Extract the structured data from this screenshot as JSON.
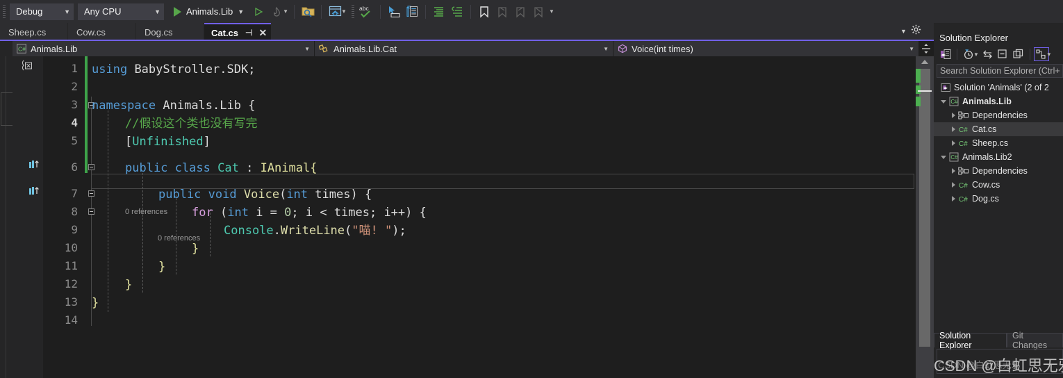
{
  "toolbar": {
    "config_combo": "Debug",
    "platform_combo": "Any CPU",
    "run_label": "Animals.Lib",
    "icons": [
      "folder-search-icon",
      "window-home-icon",
      "abc-spellcheck-icon",
      "pointer-comment-icon",
      "clipboard-list-icon",
      "comment-out-icon",
      "uncomment-icon",
      "bookmark-icon",
      "bookmark-prev-icon",
      "bookmark-next-icon",
      "bookmark-clear-icon"
    ]
  },
  "tabs": {
    "items": [
      {
        "label": "Sheep.cs",
        "active": false
      },
      {
        "label": "Cow.cs",
        "active": false
      },
      {
        "label": "Dog.cs",
        "active": false
      },
      {
        "label": "Cat.cs",
        "active": true
      }
    ],
    "pin_glyph": "⊣",
    "close_glyph": "✕"
  },
  "navbar": {
    "project": "Animals.Lib",
    "type": "Animals.Lib.Cat",
    "member": "Voice(int times)",
    "project_icon": "csharp-project-icon",
    "type_icon": "class-icon",
    "member_icon": "method-icon",
    "split_icon": "split-view-icon"
  },
  "editor": {
    "lines": [
      {
        "n": "1",
        "current": false
      },
      {
        "n": "2",
        "current": false
      },
      {
        "n": "3",
        "current": false
      },
      {
        "n": "4",
        "current": true
      },
      {
        "n": "5",
        "current": false
      },
      {
        "n": "6",
        "current": false
      },
      {
        "n": "7",
        "current": false
      },
      {
        "n": "8",
        "current": false
      },
      {
        "n": "9",
        "current": false
      },
      {
        "n": "10",
        "current": false
      },
      {
        "n": "11",
        "current": false
      },
      {
        "n": "12",
        "current": false
      },
      {
        "n": "13",
        "current": false
      },
      {
        "n": "14",
        "current": false
      }
    ],
    "code": {
      "l1_using": "using",
      "l1_ns": "BabyStroller.SDK;",
      "l3_kw": "namespace",
      "l3_name": "Animals.Lib {",
      "l4_comment": "//假设这个类也没有写完",
      "l5_attr_open": "[",
      "l5_attr": "Unfinished",
      "l5_attr_close": "]",
      "l6_public": "public",
      "l6_class": "class",
      "l6_name": "Cat",
      "l6_colon": ":",
      "l6_iface": "IAnimal{",
      "l7_public": "public",
      "l7_void": "void",
      "l7_method": "Voice",
      "l7_paren_open": "(",
      "l7_int": "int",
      "l7_param": "times",
      "l7_paren_close": ") {",
      "l8_for": "for",
      "l8_open": "(",
      "l8_int": "int",
      "l8_i": "i = ",
      "l8_zero": "0",
      "l8_semi": "; i < times; i++) {",
      "l9_console": "Console",
      "l9_dot": ".",
      "l9_write": "WriteLine",
      "l9_open": "(",
      "l9_str": "\"喵! \"",
      "l9_close": ");",
      "l10_brace": "}",
      "l11_brace": "}",
      "l12_brace": "}",
      "l13_brace": "}"
    },
    "codelens": [
      {
        "text": "0 references",
        "for": "class Cat"
      },
      {
        "text": "0 references",
        "for": "method Voice"
      }
    ],
    "glyphs": [
      "implements-interface-icon",
      "implements-interface-icon"
    ]
  },
  "solution_explorer": {
    "title": "Solution Explorer",
    "search_placeholder": "Search Solution Explorer (Ctrl+",
    "toolbar_icons": [
      "code-view-icon",
      "pending-changes-clock-icon",
      "sync-with-active-doc-icon",
      "collapse-all-icon",
      "show-all-files-icon",
      "properties-icon"
    ],
    "tree": [
      {
        "label": "Solution 'Animals' (2 of 2",
        "icon": "solution-icon",
        "indent": 0,
        "expander": "none",
        "bold": false,
        "selected": false
      },
      {
        "label": "Animals.Lib",
        "icon": "csharp-project-icon",
        "indent": 1,
        "expander": "down",
        "bold": true,
        "selected": false
      },
      {
        "label": "Dependencies",
        "icon": "dependencies-icon",
        "indent": 2,
        "expander": "right",
        "bold": false,
        "selected": false
      },
      {
        "label": "Cat.cs",
        "icon": "csharp-file-icon",
        "indent": 2,
        "expander": "right",
        "bold": false,
        "selected": true
      },
      {
        "label": "Sheep.cs",
        "icon": "csharp-file-icon",
        "indent": 2,
        "expander": "right",
        "bold": false,
        "selected": false
      },
      {
        "label": "Animals.Lib2",
        "icon": "csharp-project-icon",
        "indent": 1,
        "expander": "down",
        "bold": false,
        "selected": false
      },
      {
        "label": "Dependencies",
        "icon": "dependencies-icon",
        "indent": 2,
        "expander": "right",
        "bold": false,
        "selected": false
      },
      {
        "label": "Cow.cs",
        "icon": "csharp-file-icon",
        "indent": 2,
        "expander": "right",
        "bold": false,
        "selected": false
      },
      {
        "label": "Dog.cs",
        "icon": "csharp-file-icon",
        "indent": 2,
        "expander": "right",
        "bold": false,
        "selected": false
      }
    ],
    "bottom_tabs": [
      {
        "label": "Solution Explorer",
        "active": true
      },
      {
        "label": "Git Changes",
        "active": false
      }
    ]
  },
  "watermarks": {
    "primary": "CSDN @白虹思无邪",
    "secondary": "CSDN @白虹思无邪"
  },
  "colors": {
    "accent": "#7160e8",
    "toolbar_bg": "#2d2d30",
    "editor_bg": "#1e1e1e",
    "panel_bg": "#252526",
    "comment_green": "#57a64a",
    "keyword_blue": "#569cd6",
    "type_teal": "#4ec9b0",
    "string_orange": "#ce9178",
    "change_bar_green": "#3ea34a"
  }
}
